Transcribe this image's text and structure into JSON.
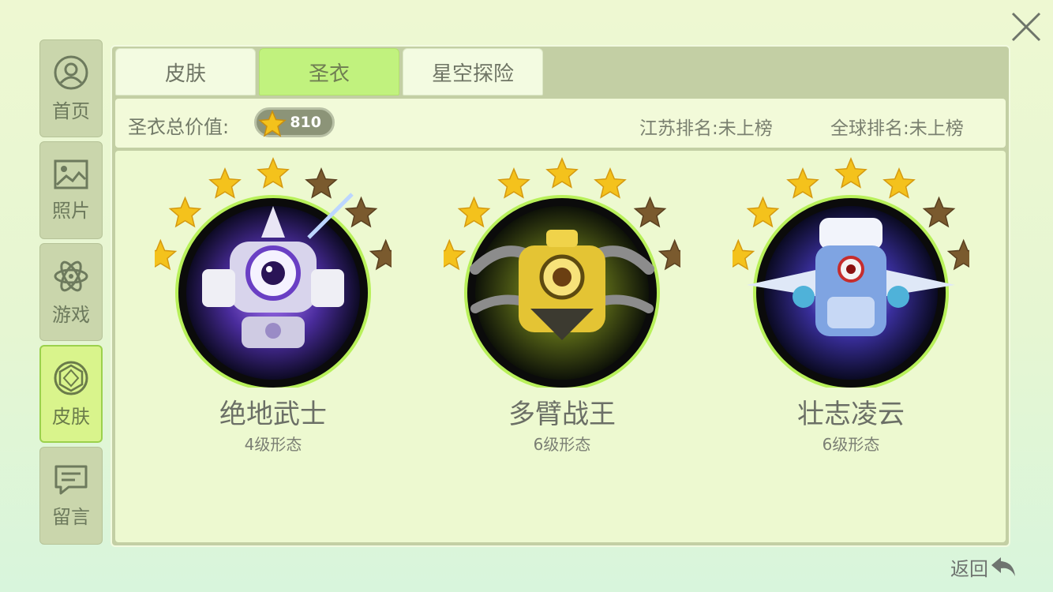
{
  "sidebar": {
    "items": [
      {
        "label": "首页",
        "icon": "user-icon"
      },
      {
        "label": "照片",
        "icon": "photo-icon"
      },
      {
        "label": "游戏",
        "icon": "atom-icon"
      },
      {
        "label": "皮肤",
        "icon": "gem-icon"
      },
      {
        "label": "留言",
        "icon": "message-icon"
      }
    ],
    "active_index": 3
  },
  "tabs": [
    {
      "label": "皮肤"
    },
    {
      "label": "圣衣"
    },
    {
      "label": "星空探险"
    }
  ],
  "active_tab": 1,
  "info": {
    "total_value_label": "圣衣总价值:",
    "total_value": "810",
    "jiangsu_rank": "江苏排名:未上榜",
    "global_rank": "全球排名:未上榜"
  },
  "suits": [
    {
      "name": "绝地武士",
      "level": "4级形态",
      "stars_filled": 4,
      "stars_total": 7,
      "theme": "purple"
    },
    {
      "name": "多臂战王",
      "level": "6级形态",
      "stars_filled": 5,
      "stars_total": 7,
      "theme": "gold"
    },
    {
      "name": "壮志凌云",
      "level": "6级形态",
      "stars_filled": 5,
      "stars_total": 7,
      "theme": "blue"
    }
  ],
  "back_label": "返回",
  "colors": {
    "accent_green": "#c1f27e",
    "star_gold": "#f4c21c",
    "star_dark": "#7a5a2e",
    "orb_ring": "#b8f05a"
  }
}
